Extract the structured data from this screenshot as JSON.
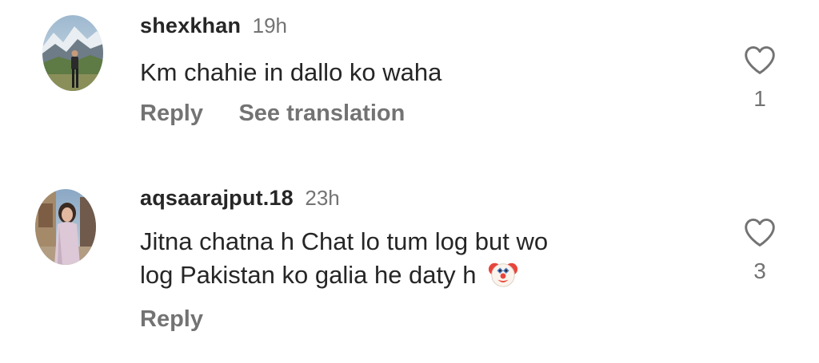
{
  "comments": [
    {
      "username": "shexkhan",
      "time": "19h",
      "text": "Km chahie in dallo ko waha",
      "actions": [
        "Reply",
        "See translation"
      ],
      "likes": "1",
      "avatar_icon": "profile-photo-mountain"
    },
    {
      "username": "aqsaarajput.18",
      "time": "23h",
      "text_line1": "Jitna chatna h Chat lo tum log but wo",
      "text_line2": "log Pakistan ko galia he daty h",
      "emoji": "clown-face-emoji",
      "actions": [
        "Reply"
      ],
      "likes": "3",
      "avatar_icon": "profile-photo-girl"
    }
  ],
  "colors": {
    "text": "#262626",
    "secondary": "#737373",
    "background": "#ffffff"
  },
  "icons": {
    "like": "heart-outline-icon"
  }
}
